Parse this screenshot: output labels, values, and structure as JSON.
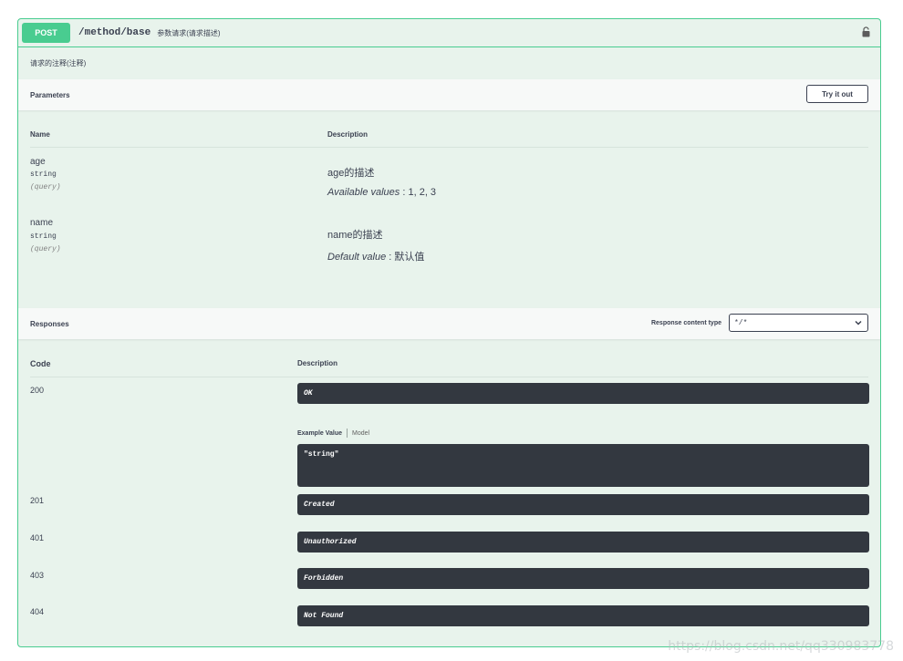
{
  "operation": {
    "method": "POST",
    "path": "/method/base",
    "summary": "参数请求(请求描述)",
    "description": "请求的注释(注释)"
  },
  "parameters": {
    "title": "Parameters",
    "try_label": "Try it out",
    "col_name": "Name",
    "col_desc": "Description",
    "items": [
      {
        "name": "age",
        "type": "string",
        "in": "(query)",
        "desc": "age的描述",
        "extra_label": "Available values",
        "extra_value": " : 1, 2, 3"
      },
      {
        "name": "name",
        "type": "string",
        "in": "(query)",
        "desc": "name的描述",
        "extra_label": "Default value",
        "extra_value": " : 默认值"
      }
    ]
  },
  "responses": {
    "title": "Responses",
    "content_type_label": "Response content type",
    "content_type_value": "*/*",
    "col_code": "Code",
    "col_desc": "Description",
    "example_tab": "Example Value",
    "model_tab": "Model",
    "example_value": "\"string\"",
    "items": [
      {
        "code": "200",
        "desc": "OK"
      },
      {
        "code": "201",
        "desc": "Created"
      },
      {
        "code": "401",
        "desc": "Unauthorized"
      },
      {
        "code": "403",
        "desc": "Forbidden"
      },
      {
        "code": "404",
        "desc": "Not Found"
      }
    ]
  },
  "watermark": "https://blog.csdn.net/qq330983778",
  "colors": {
    "post": "#49cc90",
    "bg": "#e8f3ec",
    "code_bg": "#333840"
  },
  "icons": {
    "lock": "lock-icon",
    "select": "chevron-down-icon"
  }
}
